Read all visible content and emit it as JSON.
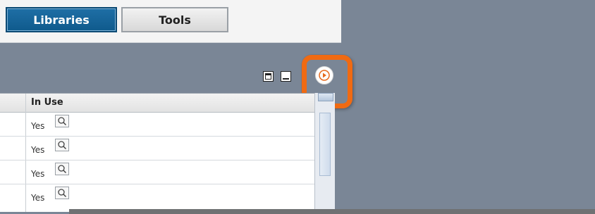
{
  "tabs": [
    {
      "label": "Libraries",
      "active": true
    },
    {
      "label": "Tools",
      "active": false
    }
  ],
  "window_controls": {
    "maximize_icon": "maximize-icon",
    "minimize_icon": "minimize-icon",
    "collapse_icon": "play-arrow-icon"
  },
  "table": {
    "header": "In Use",
    "rows": [
      {
        "in_use": "Yes",
        "icon": "magnifier-icon"
      },
      {
        "in_use": "Yes",
        "icon": "magnifier-icon"
      },
      {
        "in_use": "Yes",
        "icon": "magnifier-icon"
      },
      {
        "in_use": "Yes",
        "icon": "magnifier-icon"
      }
    ]
  },
  "colors": {
    "highlight": "#f06a12",
    "active_tab": "#0f5a8c",
    "background": "#7a8696"
  }
}
